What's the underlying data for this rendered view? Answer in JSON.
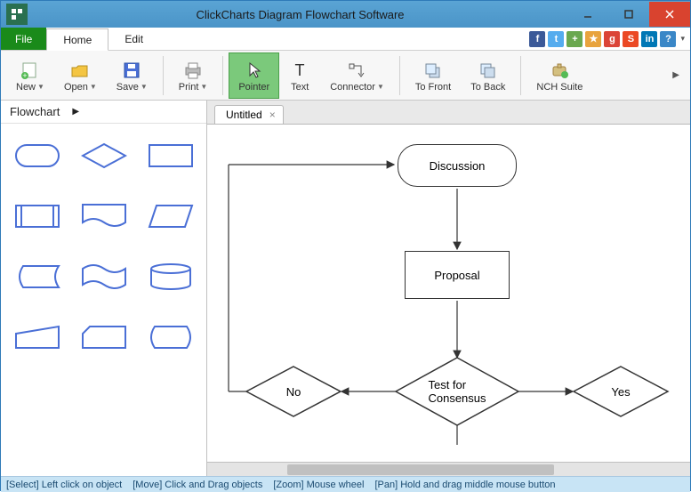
{
  "window": {
    "title": "ClickCharts Diagram Flowchart Software"
  },
  "menu": {
    "file": "File",
    "tabs": [
      "Home",
      "Edit"
    ],
    "active_tab": 0
  },
  "social_icons": [
    {
      "name": "facebook-icon",
      "bg": "#3b5998",
      "glyph": "f"
    },
    {
      "name": "twitter-icon",
      "bg": "#55acee",
      "glyph": "t"
    },
    {
      "name": "share-icon",
      "bg": "#6aa84f",
      "glyph": "+"
    },
    {
      "name": "bookmark-icon",
      "bg": "#e8a33d",
      "glyph": "★"
    },
    {
      "name": "google-icon",
      "bg": "#db4437",
      "glyph": "g"
    },
    {
      "name": "stumble-icon",
      "bg": "#eb4924",
      "glyph": "S"
    },
    {
      "name": "linkedin-icon",
      "bg": "#0077b5",
      "glyph": "in"
    },
    {
      "name": "help-icon",
      "bg": "#3a87c7",
      "glyph": "?"
    }
  ],
  "toolbar": {
    "items": [
      {
        "id": "new",
        "label": "New",
        "split": true
      },
      {
        "id": "open",
        "label": "Open",
        "split": true
      },
      {
        "id": "save",
        "label": "Save",
        "split": true
      },
      {
        "id": "print",
        "label": "Print",
        "split": true
      },
      {
        "id": "pointer",
        "label": "Pointer",
        "active": true
      },
      {
        "id": "text",
        "label": "Text"
      },
      {
        "id": "connector",
        "label": "Connector",
        "split": true
      },
      {
        "id": "tofront",
        "label": "To Front"
      },
      {
        "id": "toback",
        "label": "To Back"
      },
      {
        "id": "nchsuite",
        "label": "NCH Suite"
      }
    ]
  },
  "sidebar": {
    "category": "Flowchart",
    "shapes": [
      "terminator",
      "decision",
      "process",
      "predefined",
      "document",
      "data",
      "stored-data",
      "tape",
      "database",
      "manual-input",
      "card",
      "display"
    ]
  },
  "document": {
    "tab_name": "Untitled"
  },
  "flowchart": {
    "nodes": {
      "discussion": "Discussion",
      "proposal": "Proposal",
      "test": "Test for\nConsensus",
      "no": "No",
      "yes": "Yes"
    }
  },
  "status": {
    "select": "[Select] Left click on object",
    "move": "[Move] Click and Drag objects",
    "zoom": "[Zoom] Mouse wheel",
    "pan": "[Pan] Hold and drag middle mouse button"
  }
}
